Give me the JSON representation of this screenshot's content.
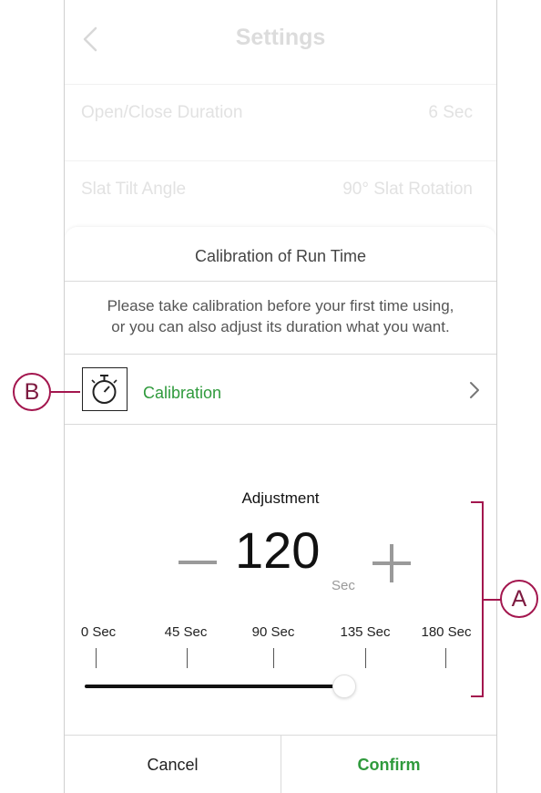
{
  "header": {
    "title": "Settings"
  },
  "background_rows": [
    {
      "label": "Open/Close Duration",
      "value": "6 Sec"
    },
    {
      "label": "Slat Tilt Angle",
      "value": "90° Slat Rotation"
    }
  ],
  "sheet": {
    "title": "Calibration of Run Time",
    "description_line1": "Please take calibration before your first time using,",
    "description_line2": "or you can also adjust its duration what you want.",
    "calibration_label": "Calibration",
    "adjustment_title": "Adjustment",
    "value": "120",
    "unit": "Sec",
    "ticks": [
      "0 Sec",
      "45 Sec",
      "90 Sec",
      "135 Sec",
      "180 Sec"
    ],
    "slider_value_sec": 120,
    "slider_max_sec": 180,
    "cancel_label": "Cancel",
    "confirm_label": "Confirm"
  },
  "annotations": {
    "a": "A",
    "b": "B"
  },
  "colors": {
    "accent_green": "#2f9a3c",
    "annotation": "#a3164e"
  },
  "icons": [
    "chevron-left-icon",
    "stopwatch-icon",
    "chevron-right-icon",
    "minus-icon",
    "plus-icon"
  ]
}
